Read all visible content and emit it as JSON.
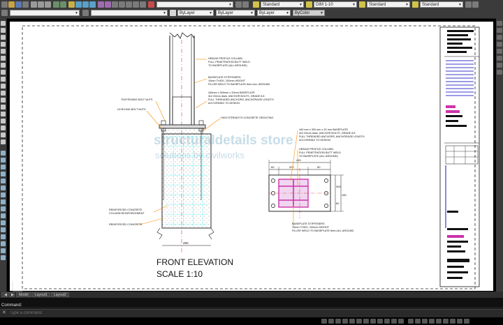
{
  "toolbar": {
    "layer_combo": "",
    "color_combo": "ByLayer",
    "linetype_combo": "ByLayer",
    "lineweight_combo": "ByLayer",
    "plotstyle_combo": "ByColor",
    "text_style": "Standard",
    "dim_style": "DIM 1-10",
    "table_style": "Standard",
    "multileader_style": "Standard"
  },
  "drawing": {
    "title": "FRONT ELEVATION",
    "scale": "SCALE 1:10",
    "watermark_line1": "structuraldetails store",
    "watermark_line2": "solutions by civilworks",
    "notes": {
      "column": [
        "HEB240 PROFILE COLUMN",
        "FULL PENETRATION BUTT WELD",
        "TO BASEPLATE (ALL AROUND)"
      ],
      "stiffeners": [
        "BASEPLATE STIFFENERS",
        "10mm THICK, 200mm HEIGHT",
        "FILLER WELD TO BASEPLATE 6mm ALL AROUND"
      ],
      "baseplate": [
        "440mm x 300mm x 20mm BASEPLATE",
        "3x2 20mm diam. ANCHOR BOLTS, GRADE 8.8",
        "FULL THREADED ANCHORS, ANCHORAGE LENGTH",
        "ACCORDING TO DESIGN"
      ],
      "tightening_nuts": "TIGHTENING BOLT NUTS",
      "leveling_nuts": "LEVELING BOLT NUTS",
      "grouting": "HIGH STRENGTH CONCRETE GROUTING",
      "rc_column": [
        "REINFORCED CONCRETE",
        "COLUMN REINFORCEMENT"
      ],
      "rc": "REINFORCED CONCRETE",
      "plan_baseplate": [
        "440 mm x 300 mm x 20 mm BASEPLATE",
        "3x2 20mm diam. ANCHOR BOLTS, GRADE 8.8",
        "FULL THREADED ANCHORS, ANCHORAGE LENGTH",
        "ACCORDING TO DESIGN"
      ],
      "plan_column": [
        "HEB240 PROFILE COLUMN",
        "FULL PENETRATION BUTT WELD",
        "TO BASEPLATE (ALL AROUND)"
      ],
      "plan_stiffeners": [
        "BASEPLATE STIFFENERS",
        "10mm THICK, 200mm HEIGHT",
        "FILLER WELD TO BASEPLATE 6mm ALL AROUND"
      ]
    },
    "dims": {
      "top_total": "440",
      "top_left": "60",
      "top_mid": "320",
      "top_right": "60",
      "side_1": "300",
      "side_2": "60",
      "side_3": "180",
      "bottom_width": "450"
    }
  },
  "layout_tabs": [
    "Model",
    "Layout1",
    "Layout2"
  ],
  "command": {
    "label": "Command:",
    "placeholder": "Type a command"
  },
  "colors": {
    "accent": "#ff8c00",
    "cyan": "#00d8d8",
    "magenta": "#ff00ff",
    "grid_line": "#00ffff"
  }
}
